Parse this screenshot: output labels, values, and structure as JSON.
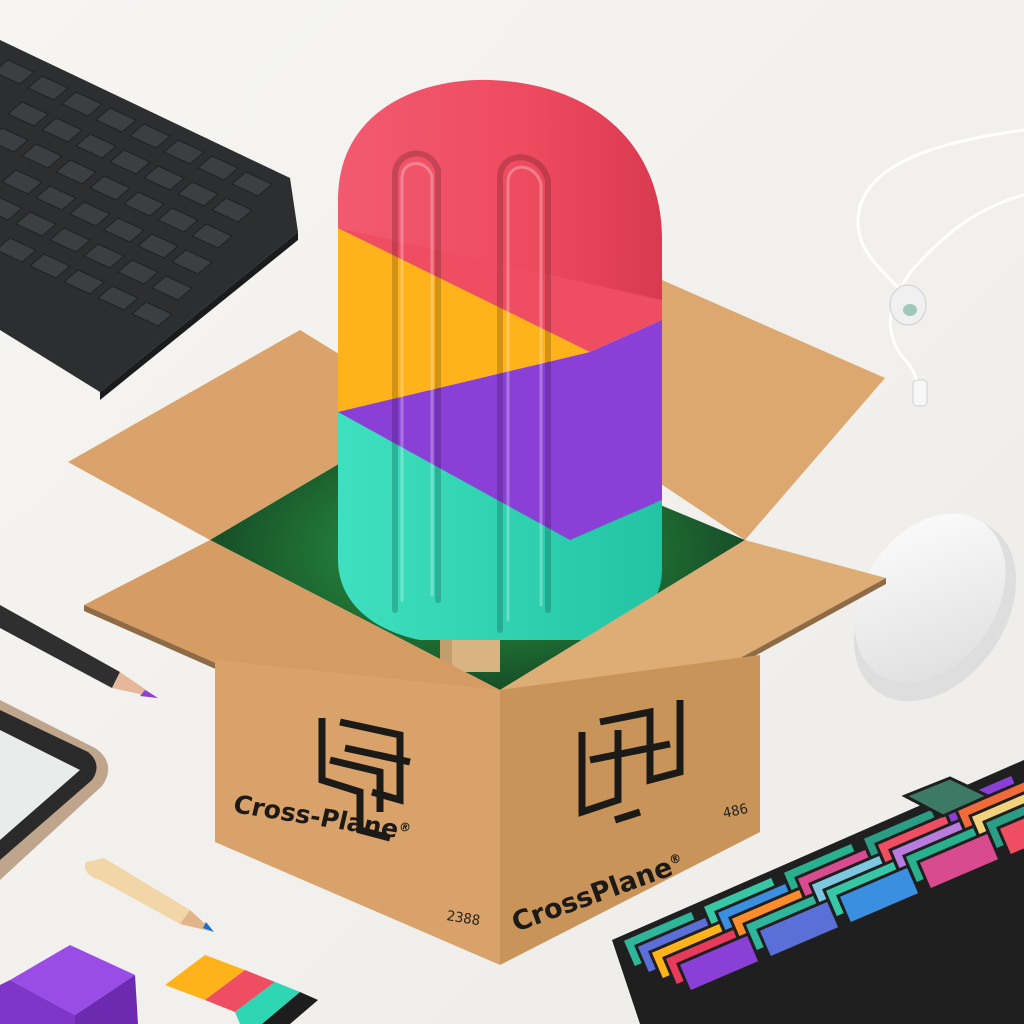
{
  "scene": {
    "subject": "popsicle-in-box",
    "colors": {
      "background": "#f3f2ef",
      "cardboard": "#d9a36b",
      "cardboard_dark": "#b98551",
      "popsicle_red": "#ef4d62",
      "popsicle_orange": "#ffb21a",
      "popsicle_purple": "#8a3fd6",
      "popsicle_teal": "#2fd6b4"
    }
  },
  "box": {
    "front_brand": "Cross-Plane",
    "front_brand_mark": "®",
    "front_code": "2388",
    "side_brand": "CrossPlane",
    "side_brand_mark": "®",
    "side_code": "486",
    "front_icon": "crossplane-logo-icon",
    "side_icon": "crossplane-logo-icon"
  }
}
